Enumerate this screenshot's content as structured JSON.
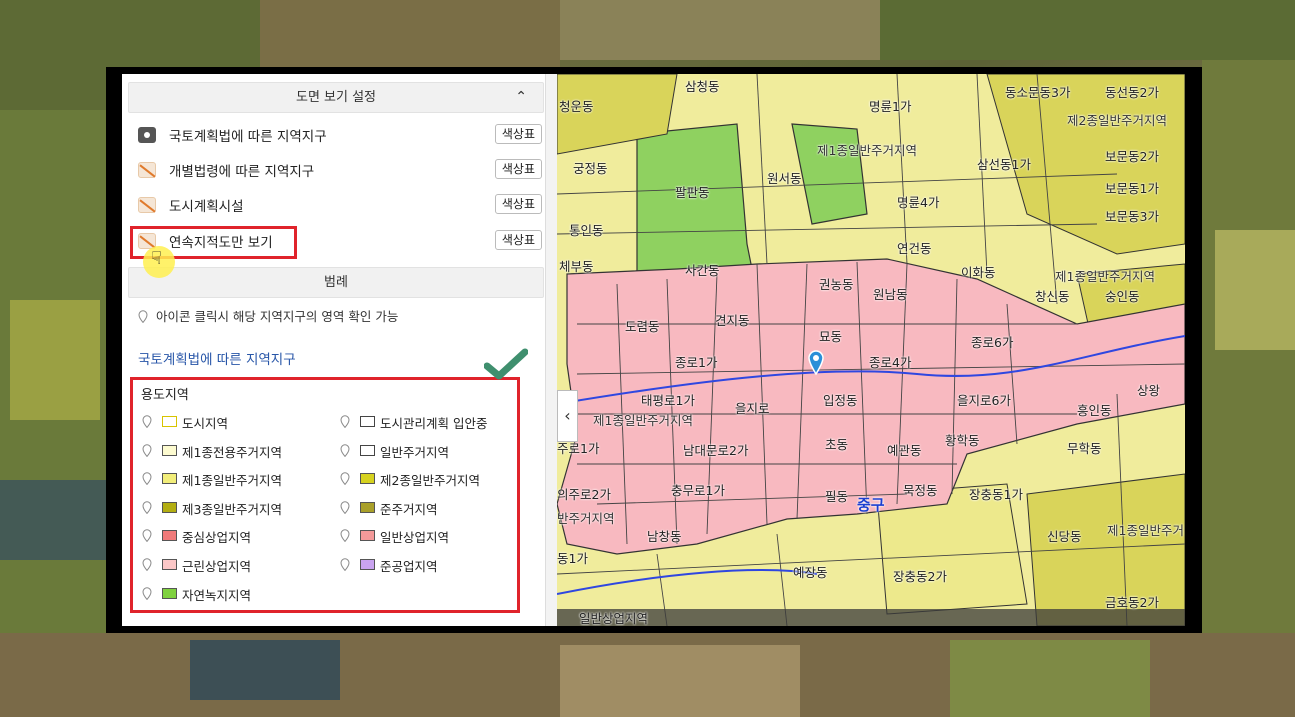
{
  "panel": {
    "settings_title": "도면 보기 설정",
    "layers": [
      {
        "label": "국토계획법에 따른 지역지구",
        "button": "색상표",
        "visible": true
      },
      {
        "label": "개별법령에 따른 지역지구",
        "button": "색상표",
        "visible": false
      },
      {
        "label": "도시계획시설",
        "button": "색상표",
        "visible": false
      },
      {
        "label": "연속지적도만 보기",
        "button": "색상표",
        "visible": false
      }
    ],
    "legend_title": "범례",
    "info_text": "아이콘 클릭시 해당 지역지구의 영역 확인 가능",
    "zone_law_title": "국토계획법에 따른 지역지구",
    "use_zone_title": "용도지역",
    "legend_items": [
      {
        "label": "도시지역",
        "color": "#ffffff",
        "border": "#d8c400"
      },
      {
        "label": "도시관리계획 입안중",
        "color": "#ffffff",
        "border": "#444444"
      },
      {
        "label": "제1종전용주거지역",
        "color": "#fdfbd0",
        "border": "#555555"
      },
      {
        "label": "일반주거지역",
        "color": "#ffffff",
        "border": "#444444"
      },
      {
        "label": "제1종일반주거지역",
        "color": "#f2ee7a",
        "border": "#555555"
      },
      {
        "label": "제2종일반주거지역",
        "color": "#d6d21f",
        "border": "#555555"
      },
      {
        "label": "제3종일반주거지역",
        "color": "#b3ae12",
        "border": "#555555"
      },
      {
        "label": "준주거지역",
        "color": "#a9a02a",
        "border": "#555555"
      },
      {
        "label": "중심상업지역",
        "color": "#f07a7a",
        "border": "#555555"
      },
      {
        "label": "일반상업지역",
        "color": "#f49a9a",
        "border": "#555555"
      },
      {
        "label": "근린상업지역",
        "color": "#fcc7c7",
        "border": "#555555"
      },
      {
        "label": "준공업지역",
        "color": "#c9a3f0",
        "border": "#555555"
      },
      {
        "label": "자연녹지지역",
        "color": "#7fd13f",
        "border": "#555555"
      }
    ]
  },
  "map": {
    "labels": [
      "삼청동",
      "청운동",
      "명륜1가",
      "동소문동3가",
      "동선동2가",
      "제2종일반주거지역",
      "제1종일반주거지역",
      "삼선동1가",
      "보문동2가",
      "궁정동",
      "팔판동",
      "원서동",
      "명륜4가",
      "보문동1가",
      "통인동",
      "연건동",
      "보문동3가",
      "사간동",
      "체부동",
      "이화동",
      "제1종일반주거지역",
      "창신동",
      "숭인동",
      "권농동",
      "원남동",
      "도렴동",
      "견지동",
      "묘동",
      "종로6가",
      "종로1가",
      "종로4가",
      "태평로1가",
      "을지로6가",
      "상왕",
      "제1종일반주거지역",
      "을지로",
      "입정동",
      "흥인동",
      "무학동",
      "주로1가",
      "남대문로2가",
      "초동",
      "예관동",
      "황학동",
      "의주로2가",
      "충무로1가",
      "필동",
      "묵정동",
      "장충동1가",
      "반주거지역",
      "남창동",
      "중구",
      "신당동",
      "제1종일반주거",
      "동1가",
      "예장동",
      "장충동2가",
      "금호동2가",
      "일반상업지역"
    ],
    "district_label": "중구"
  }
}
